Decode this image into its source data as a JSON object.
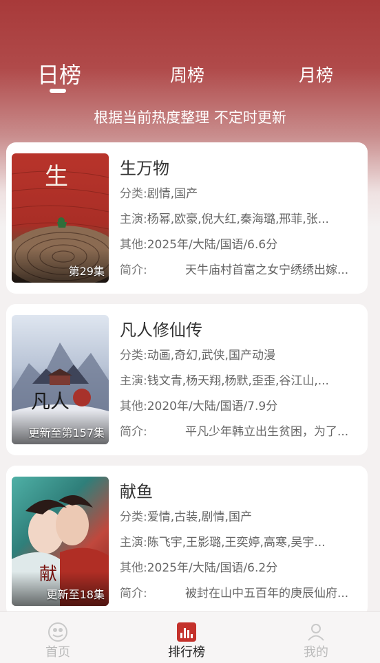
{
  "tabs": [
    {
      "label": "日榜",
      "active": true
    },
    {
      "label": "周榜",
      "active": false
    },
    {
      "label": "月榜",
      "active": false
    }
  ],
  "subtitle": "根据当前热度整理 不定时更新",
  "items": [
    {
      "title": "生万物",
      "badge": "第29集",
      "category_label": "分类:",
      "category": "剧情,国产",
      "cast_label": "主演:",
      "cast": "杨幂,欧豪,倪大红,秦海璐,邢菲,张...",
      "other_label": "其他:",
      "other": "2025年/大陆/国语/6.6分",
      "intro_label": "简介:",
      "intro": "天牛庙村首富之女宁绣绣出嫁...",
      "poster_colors": [
        "#b8342b",
        "#8a2a22"
      ]
    },
    {
      "title": "凡人修仙传",
      "badge": "更新至第157集",
      "category_label": "分类:",
      "category": "动画,奇幻,武侠,国产动漫",
      "cast_label": "主演:",
      "cast": "钱文青,杨天翔,杨默,歪歪,谷江山,...",
      "other_label": "其他:",
      "other": "2020年/大陆/国语/7.9分",
      "intro_label": "简介:",
      "intro": "平凡少年韩立出生贫困，为了...",
      "poster_colors": [
        "#c9d3e3",
        "#6f7f9a"
      ]
    },
    {
      "title": "献鱼",
      "badge": "更新至18集",
      "category_label": "分类:",
      "category": "爱情,古装,剧情,国产",
      "cast_label": "主演:",
      "cast": "陈飞宇,王影璐,王奕婷,高寒,吴宇...",
      "other_label": "其他:",
      "other": "2025年/大陆/国语/6.2分",
      "intro_label": "简介:",
      "intro": "被封在山中五百年的庚辰仙府...",
      "poster_colors": [
        "#3f9a94",
        "#b5443a"
      ]
    }
  ],
  "bottom_nav": [
    {
      "label": "首页",
      "icon": "home-icon"
    },
    {
      "label": "排行榜",
      "icon": "chart-icon"
    },
    {
      "label": "我的",
      "icon": "user-icon"
    }
  ],
  "colors": {
    "accent": "#b5443a",
    "header": "#a83a3a"
  }
}
